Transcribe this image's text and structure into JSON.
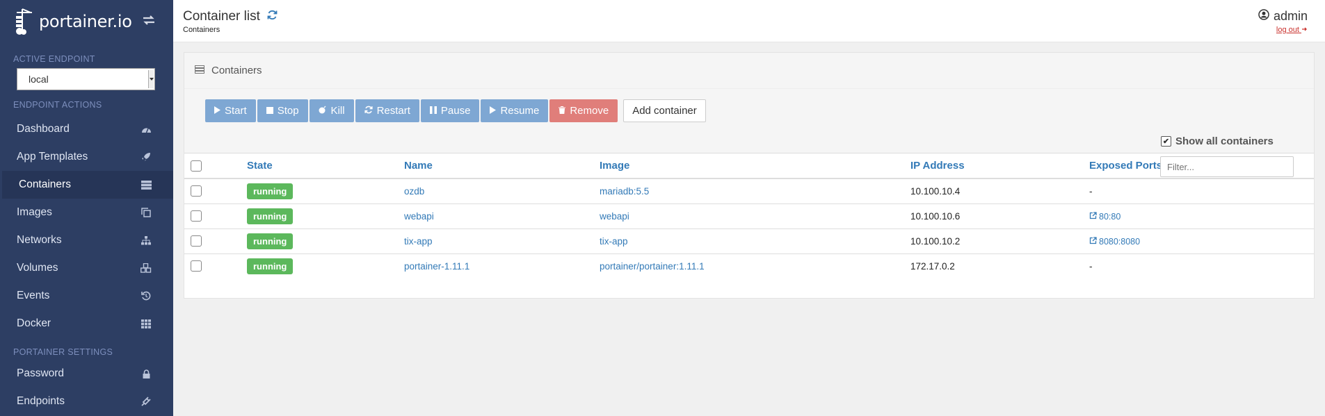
{
  "brand": {
    "name": "portainer.io"
  },
  "sidebar": {
    "active_endpoint_title": "ACTIVE ENDPOINT",
    "endpoint_value": "local",
    "endpoint_actions_title": "ENDPOINT ACTIONS",
    "items": [
      {
        "label": "Dashboard",
        "icon": "dashboard-icon"
      },
      {
        "label": "App Templates",
        "icon": "rocket-icon"
      },
      {
        "label": "Containers",
        "icon": "server-icon",
        "active": true
      },
      {
        "label": "Images",
        "icon": "clone-icon"
      },
      {
        "label": "Networks",
        "icon": "sitemap-icon"
      },
      {
        "label": "Volumes",
        "icon": "cubes-icon"
      },
      {
        "label": "Events",
        "icon": "history-icon"
      },
      {
        "label": "Docker",
        "icon": "th-icon"
      }
    ],
    "portainer_settings_title": "PORTAINER SETTINGS",
    "settings_items": [
      {
        "label": "Password",
        "icon": "lock-icon"
      },
      {
        "label": "Endpoints",
        "icon": "plug-icon"
      }
    ]
  },
  "header": {
    "title": "Container list",
    "breadcrumb": "Containers",
    "user": "admin",
    "logout": "log out"
  },
  "widget": {
    "title": "Containers",
    "buttons": {
      "start": "Start",
      "stop": "Stop",
      "kill": "Kill",
      "restart": "Restart",
      "pause": "Pause",
      "resume": "Resume",
      "remove": "Remove",
      "add": "Add container"
    },
    "show_all_label": "Show all containers",
    "filter_placeholder": "Filter...",
    "columns": {
      "state": "State",
      "name": "Name",
      "image": "Image",
      "ip": "IP Address",
      "ports": "Exposed Ports"
    },
    "rows": [
      {
        "state": "running",
        "name": "ozdb",
        "image": "mariadb:5.5",
        "ip": "10.100.10.4",
        "ports": "-"
      },
      {
        "state": "running",
        "name": "webapi",
        "image": "webapi",
        "ip": "10.100.10.6",
        "ports": "80:80"
      },
      {
        "state": "running",
        "name": "tix-app",
        "image": "tix-app",
        "ip": "10.100.10.2",
        "ports": "8080:8080"
      },
      {
        "state": "running",
        "name": "portainer-1.11.1",
        "image": "portainer/portainer:1.11.1",
        "ip": "172.17.0.2",
        "ports": "-"
      }
    ]
  },
  "colors": {
    "sidebar_bg": "#2d3e63",
    "link": "#337ab7",
    "running": "#5cb85c",
    "primary_btn": "#7ea7d3",
    "danger_btn": "#e07e7a"
  }
}
